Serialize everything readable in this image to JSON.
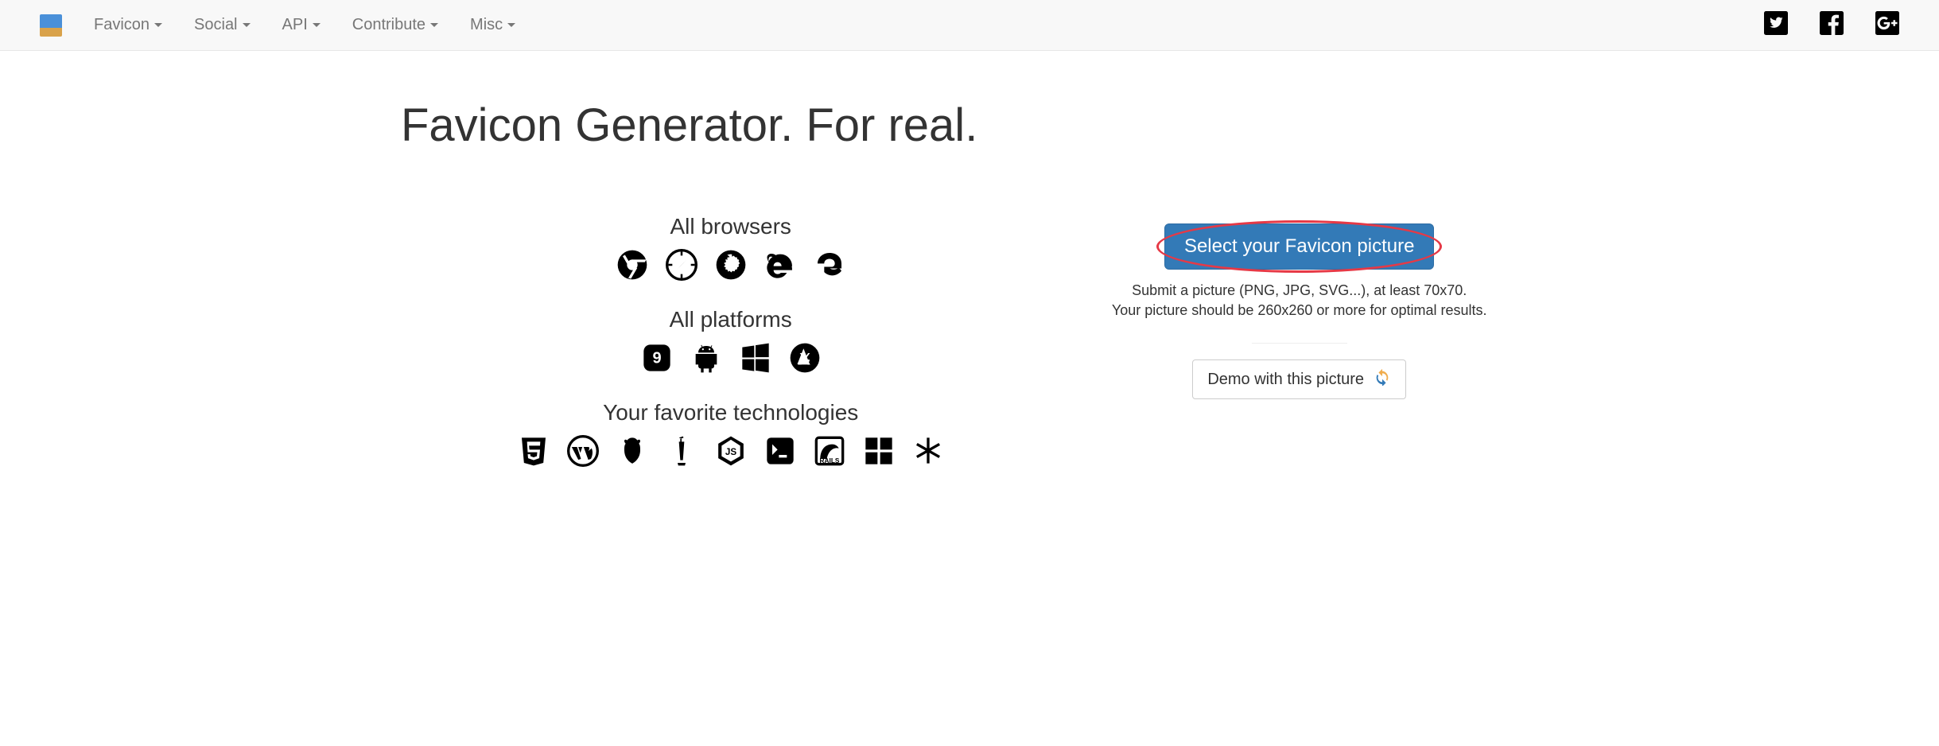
{
  "nav": {
    "items": [
      {
        "label": "Favicon"
      },
      {
        "label": "Social"
      },
      {
        "label": "API"
      },
      {
        "label": "Contribute"
      },
      {
        "label": "Misc"
      }
    ]
  },
  "hero": {
    "title": "Favicon Generator. For real."
  },
  "sections": {
    "browsers": {
      "title": "All browsers"
    },
    "platforms": {
      "title": "All platforms"
    },
    "technologies": {
      "title": "Your favorite technologies"
    }
  },
  "upload": {
    "button_label": "Select your Favicon picture",
    "hint_line1": "Submit a picture (PNG, JPG, SVG...), at least 70x70.",
    "hint_line2": "Your picture should be 260x260 or more for optimal results.",
    "demo_label": "Demo with this picture"
  }
}
